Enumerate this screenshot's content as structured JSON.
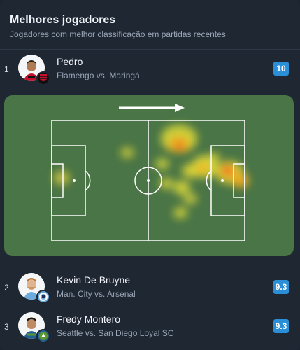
{
  "header": {
    "title": "Melhores jogadores",
    "subtitle": "Jogadores com melhor classificação em partidas recentes"
  },
  "players": [
    {
      "rank": "1",
      "name": "Pedro",
      "match": "Flamengo vs. Maringá",
      "rating": "10",
      "rating_color": "#2a8fd6",
      "club_badge": "flamengo-badge"
    },
    {
      "rank": "2",
      "name": "Kevin De Bruyne",
      "match": "Man. City vs. Arsenal",
      "rating": "9.3",
      "rating_color": "#2a8fd6",
      "club_badge": "man-city-badge"
    },
    {
      "rank": "3",
      "name": "Fredy Montero",
      "match": "Seattle vs. San Diego Loyal SC",
      "rating": "9.3",
      "rating_color": "#2a8fd6",
      "club_badge": "seattle-badge"
    }
  ],
  "heatmap": {
    "attack_direction": "right",
    "pitch_color": "#4a7546"
  }
}
